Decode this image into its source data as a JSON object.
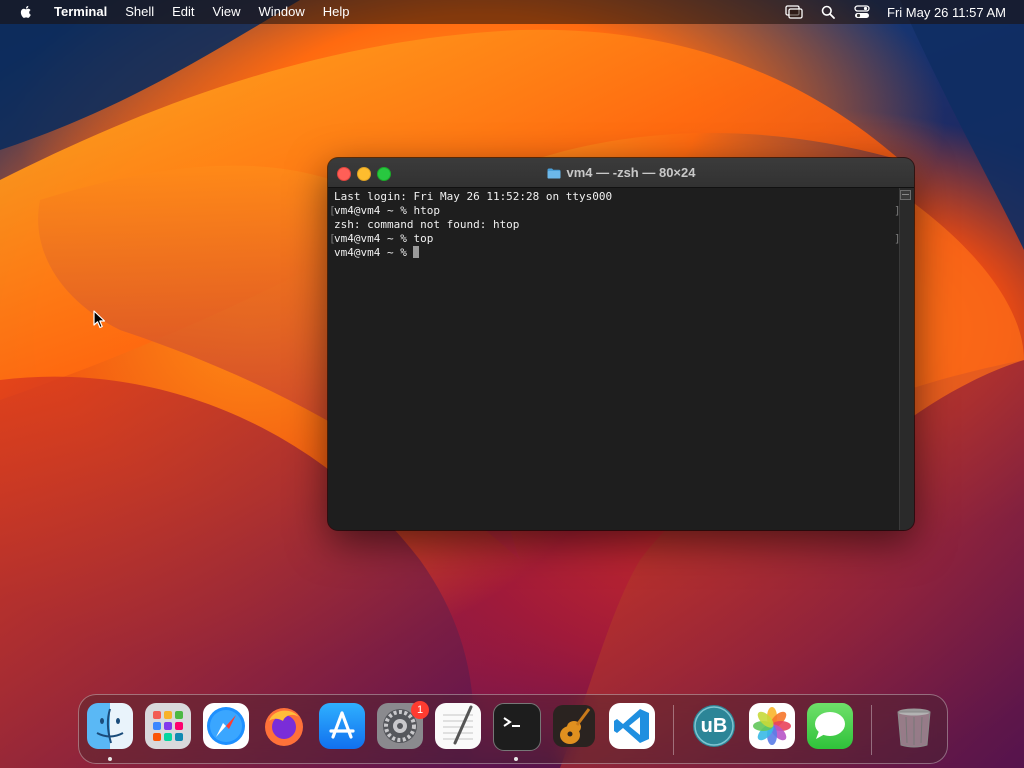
{
  "menubar": {
    "app_name": "Terminal",
    "items": [
      "Shell",
      "Edit",
      "View",
      "Window",
      "Help"
    ],
    "clock": "Fri May 26  11:57 AM",
    "status_icons": [
      "screen-mirroring-icon",
      "search-icon",
      "control-center-icon"
    ]
  },
  "terminal": {
    "title": "vm4 — -zsh — 80×24",
    "lines": [
      "Last login: Fri May 26 11:52:28 on ttys000",
      "vm4@vm4 ~ % htop",
      "zsh: command not found: htop",
      "vm4@vm4 ~ % top",
      "vm4@vm4 ~ % "
    ]
  },
  "dock": {
    "apps": [
      {
        "name": "Finder",
        "icon": "finder-icon"
      },
      {
        "name": "Launchpad",
        "icon": "launchpad-icon"
      },
      {
        "name": "Safari",
        "icon": "safari-icon"
      },
      {
        "name": "Firefox",
        "icon": "firefox-icon"
      },
      {
        "name": "App Store",
        "icon": "app-store-icon"
      },
      {
        "name": "System Preferences",
        "icon": "settings-icon",
        "badge": "1"
      },
      {
        "name": "TextEdit",
        "icon": "textedit-icon"
      },
      {
        "name": "Terminal",
        "icon": "terminal-icon"
      },
      {
        "name": "GarageBand",
        "icon": "garageband-icon"
      },
      {
        "name": "Visual Studio Code",
        "icon": "vscode-icon"
      },
      {
        "name": "uBlock",
        "icon": "ublock-icon",
        "label": "uB"
      },
      {
        "name": "Photos",
        "icon": "photos-icon"
      },
      {
        "name": "Messages",
        "icon": "messages-icon"
      },
      {
        "name": "Trash",
        "icon": "trash-icon"
      }
    ]
  },
  "colors": {
    "traffic_close": "#ff5f57",
    "traffic_minimize": "#febc2e",
    "traffic_zoom": "#28c840",
    "terminal_bg": "#1e1e1e"
  }
}
